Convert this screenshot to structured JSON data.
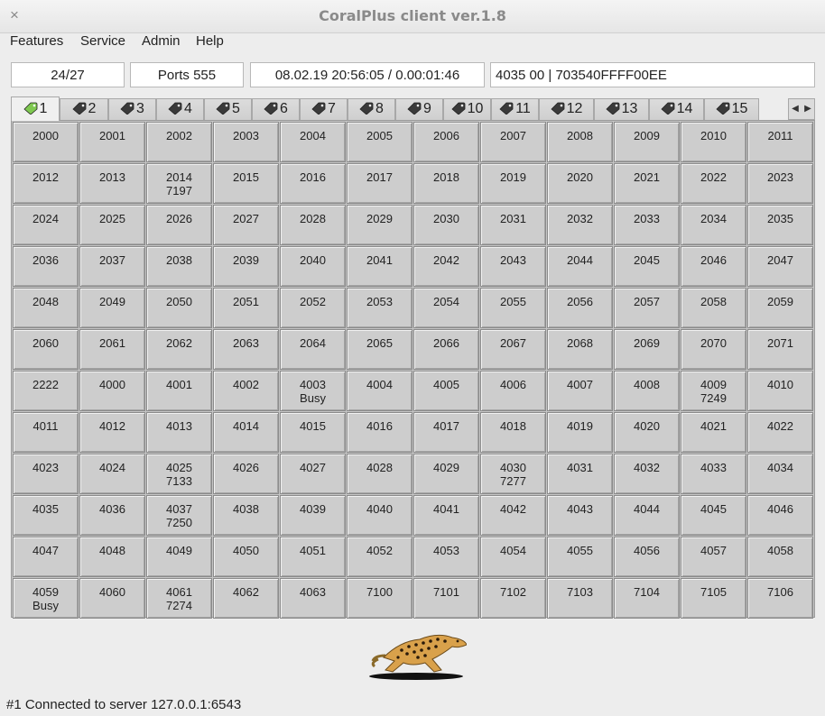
{
  "window": {
    "title": "CoralPlus client ver.1.8",
    "close_glyph": "×"
  },
  "menu": [
    "Features",
    "Service",
    "Admin",
    "Help"
  ],
  "info": {
    "count": "24/27",
    "ports": "Ports 555",
    "datetime": "08.02.19 20:56:05 / 0.00:01:46",
    "line": "4035 00 | 703540FFFF00EE"
  },
  "tabs": [
    {
      "label": "1",
      "active": true
    },
    {
      "label": "2"
    },
    {
      "label": "3"
    },
    {
      "label": "4"
    },
    {
      "label": "5"
    },
    {
      "label": "6"
    },
    {
      "label": "7"
    },
    {
      "label": "8"
    },
    {
      "label": "9"
    },
    {
      "label": "10"
    },
    {
      "label": "11"
    },
    {
      "label": "12"
    },
    {
      "label": "13"
    },
    {
      "label": "14"
    },
    {
      "label": "15"
    }
  ],
  "tab_scroll": {
    "left": "◀",
    "right": "▶"
  },
  "colors": {
    "active_tag": "#7ec850",
    "inactive_tag": "#3a3a3a"
  },
  "cells": [
    [
      "2000",
      ""
    ],
    [
      "2001",
      ""
    ],
    [
      "2002",
      ""
    ],
    [
      "2003",
      ""
    ],
    [
      "2004",
      ""
    ],
    [
      "2005",
      ""
    ],
    [
      "2006",
      ""
    ],
    [
      "2007",
      ""
    ],
    [
      "2008",
      ""
    ],
    [
      "2009",
      ""
    ],
    [
      "2010",
      ""
    ],
    [
      "2011",
      ""
    ],
    [
      "2012",
      ""
    ],
    [
      "2013",
      ""
    ],
    [
      "2014",
      "7197"
    ],
    [
      "2015",
      ""
    ],
    [
      "2016",
      ""
    ],
    [
      "2017",
      ""
    ],
    [
      "2018",
      ""
    ],
    [
      "2019",
      ""
    ],
    [
      "2020",
      ""
    ],
    [
      "2021",
      ""
    ],
    [
      "2022",
      ""
    ],
    [
      "2023",
      ""
    ],
    [
      "2024",
      ""
    ],
    [
      "2025",
      ""
    ],
    [
      "2026",
      ""
    ],
    [
      "2027",
      ""
    ],
    [
      "2028",
      ""
    ],
    [
      "2029",
      ""
    ],
    [
      "2030",
      ""
    ],
    [
      "2031",
      ""
    ],
    [
      "2032",
      ""
    ],
    [
      "2033",
      ""
    ],
    [
      "2034",
      ""
    ],
    [
      "2035",
      ""
    ],
    [
      "2036",
      ""
    ],
    [
      "2037",
      ""
    ],
    [
      "2038",
      ""
    ],
    [
      "2039",
      ""
    ],
    [
      "2040",
      ""
    ],
    [
      "2041",
      ""
    ],
    [
      "2042",
      ""
    ],
    [
      "2043",
      ""
    ],
    [
      "2044",
      ""
    ],
    [
      "2045",
      ""
    ],
    [
      "2046",
      ""
    ],
    [
      "2047",
      ""
    ],
    [
      "2048",
      ""
    ],
    [
      "2049",
      ""
    ],
    [
      "2050",
      ""
    ],
    [
      "2051",
      ""
    ],
    [
      "2052",
      ""
    ],
    [
      "2053",
      ""
    ],
    [
      "2054",
      ""
    ],
    [
      "2055",
      ""
    ],
    [
      "2056",
      ""
    ],
    [
      "2057",
      ""
    ],
    [
      "2058",
      ""
    ],
    [
      "2059",
      ""
    ],
    [
      "2060",
      ""
    ],
    [
      "2061",
      ""
    ],
    [
      "2062",
      ""
    ],
    [
      "2063",
      ""
    ],
    [
      "2064",
      ""
    ],
    [
      "2065",
      ""
    ],
    [
      "2066",
      ""
    ],
    [
      "2067",
      ""
    ],
    [
      "2068",
      ""
    ],
    [
      "2069",
      ""
    ],
    [
      "2070",
      ""
    ],
    [
      "2071",
      ""
    ],
    [
      "2222",
      ""
    ],
    [
      "4000",
      ""
    ],
    [
      "4001",
      ""
    ],
    [
      "4002",
      ""
    ],
    [
      "4003",
      "Busy"
    ],
    [
      "4004",
      ""
    ],
    [
      "4005",
      ""
    ],
    [
      "4006",
      ""
    ],
    [
      "4007",
      ""
    ],
    [
      "4008",
      ""
    ],
    [
      "4009",
      "7249"
    ],
    [
      "4010",
      ""
    ],
    [
      "4011",
      ""
    ],
    [
      "4012",
      ""
    ],
    [
      "4013",
      ""
    ],
    [
      "4014",
      ""
    ],
    [
      "4015",
      ""
    ],
    [
      "4016",
      ""
    ],
    [
      "4017",
      ""
    ],
    [
      "4018",
      ""
    ],
    [
      "4019",
      ""
    ],
    [
      "4020",
      ""
    ],
    [
      "4021",
      ""
    ],
    [
      "4022",
      ""
    ],
    [
      "4023",
      ""
    ],
    [
      "4024",
      ""
    ],
    [
      "4025",
      "7133"
    ],
    [
      "4026",
      ""
    ],
    [
      "4027",
      ""
    ],
    [
      "4028",
      ""
    ],
    [
      "4029",
      ""
    ],
    [
      "4030",
      "7277"
    ],
    [
      "4031",
      ""
    ],
    [
      "4032",
      ""
    ],
    [
      "4033",
      ""
    ],
    [
      "4034",
      ""
    ],
    [
      "4035",
      ""
    ],
    [
      "4036",
      ""
    ],
    [
      "4037",
      "7250"
    ],
    [
      "4038",
      ""
    ],
    [
      "4039",
      ""
    ],
    [
      "4040",
      ""
    ],
    [
      "4041",
      ""
    ],
    [
      "4042",
      ""
    ],
    [
      "4043",
      ""
    ],
    [
      "4044",
      ""
    ],
    [
      "4045",
      ""
    ],
    [
      "4046",
      ""
    ],
    [
      "4047",
      ""
    ],
    [
      "4048",
      ""
    ],
    [
      "4049",
      ""
    ],
    [
      "4050",
      ""
    ],
    [
      "4051",
      ""
    ],
    [
      "4052",
      ""
    ],
    [
      "4053",
      ""
    ],
    [
      "4054",
      ""
    ],
    [
      "4055",
      ""
    ],
    [
      "4056",
      ""
    ],
    [
      "4057",
      ""
    ],
    [
      "4058",
      ""
    ],
    [
      "4059",
      "Busy"
    ],
    [
      "4060",
      ""
    ],
    [
      "4061",
      "7274"
    ],
    [
      "4062",
      ""
    ],
    [
      "4063",
      ""
    ],
    [
      "7100",
      ""
    ],
    [
      "7101",
      ""
    ],
    [
      "7102",
      ""
    ],
    [
      "7103",
      ""
    ],
    [
      "7104",
      ""
    ],
    [
      "7105",
      ""
    ],
    [
      "7106",
      ""
    ]
  ],
  "status": "#1 Connected to server 127.0.0.1:6543",
  "logo": "cheetah-logo"
}
